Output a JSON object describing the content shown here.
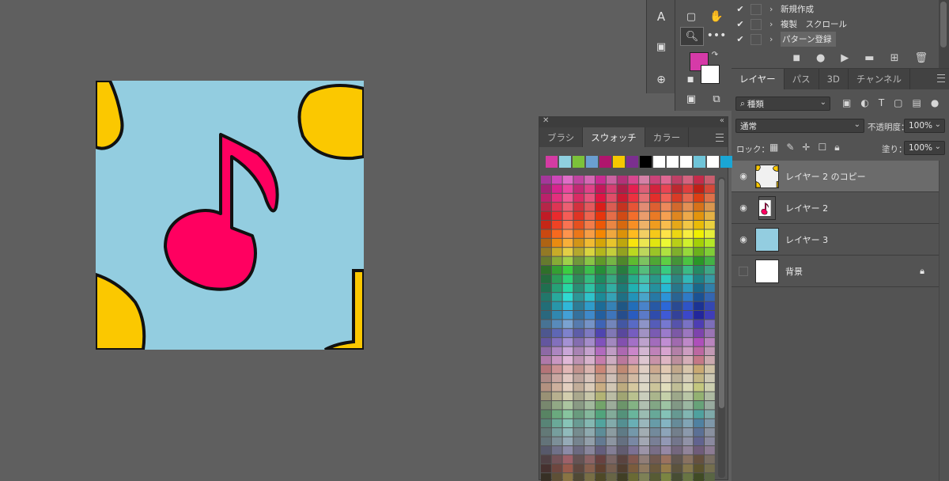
{
  "actions_panel": {
    "rows": [
      {
        "label": "新規作成",
        "checked": true
      },
      {
        "label": "複製　スクロール",
        "checked": true
      },
      {
        "label": "パターン登録",
        "checked": true,
        "selected": true
      }
    ]
  },
  "toolbar": {
    "foreground_color": "#d63aa8",
    "background_color": "#ffffff"
  },
  "swatches_panel": {
    "tabs": [
      "ブラシ",
      "スウォッチ",
      "カラー"
    ],
    "active_tab": "スウォッチ",
    "recent_colors": [
      "#d43ba3",
      "#8fd0e0",
      "#7cc23a",
      "#6a9fd0",
      "#b0156d",
      "#f5c800",
      "#7b2f8f",
      "#000000",
      "#ffffff",
      "#ffffff",
      "#ffffff",
      "#6fc4d8",
      "#ffffff",
      "#1aa6d5"
    ]
  },
  "layers_panel": {
    "tabs": [
      "レイヤー",
      "パス",
      "3D",
      "チャンネル"
    ],
    "active_tab": "レイヤー",
    "filter_label": "種類",
    "blend_mode": "通常",
    "opacity_label": "不透明度：",
    "opacity_value": "100%",
    "lock_label": "ロック：",
    "fill_label": "塗り：",
    "fill_value": "100%",
    "layers": [
      {
        "name": "レイヤー 2 のコピー",
        "visible": true,
        "selected": true
      },
      {
        "name": "レイヤー 2",
        "visible": true
      },
      {
        "name": "レイヤー 3",
        "visible": true
      },
      {
        "name": "背景",
        "visible": false,
        "locked": true
      }
    ]
  },
  "canvas": {
    "background_color": "#93cde0",
    "note_color": "#ff0060",
    "yellow_color": "#fbc800"
  }
}
